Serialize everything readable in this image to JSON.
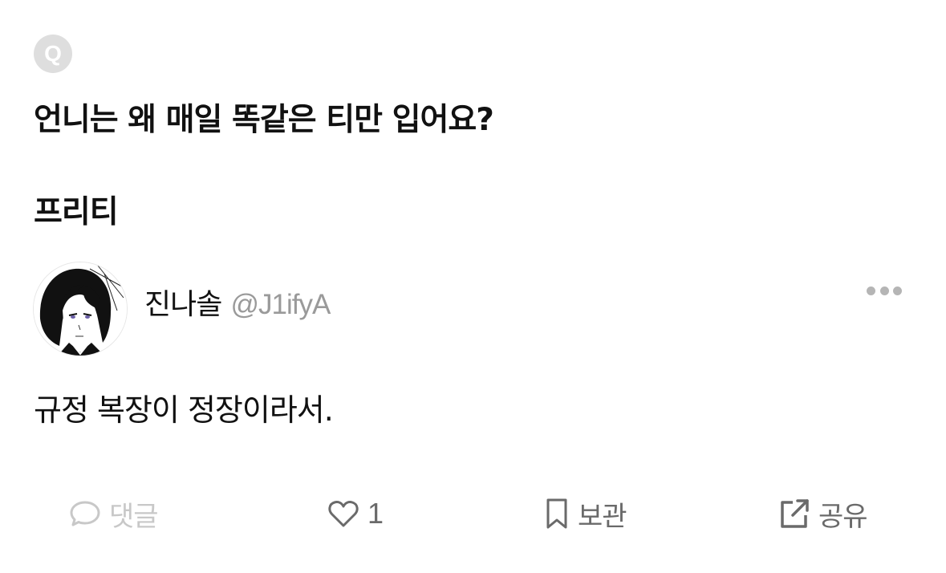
{
  "question": {
    "badge": "Q",
    "text": "언니는 왜 매일 똑같은 티만 입어요?",
    "asker": "프리티"
  },
  "answer": {
    "author_name": "진나솔",
    "author_handle": "@J1ifyA",
    "text": "규정 복장이 정장이라서."
  },
  "actions": {
    "comment_label": "댓글",
    "like_count": "1",
    "save_label": "보관",
    "share_label": "공유"
  },
  "icons": {
    "avatar": "avatar-illustration",
    "more": "more-dots-icon",
    "comment": "speech-bubble-icon",
    "like": "heart-icon",
    "save": "bookmark-icon",
    "share": "external-share-icon"
  },
  "colors": {
    "text": "#111111",
    "muted": "#9a9a9a",
    "disabled": "#c8c8c8",
    "icon": "#6a6a6a",
    "badge_bg": "#dedede"
  }
}
